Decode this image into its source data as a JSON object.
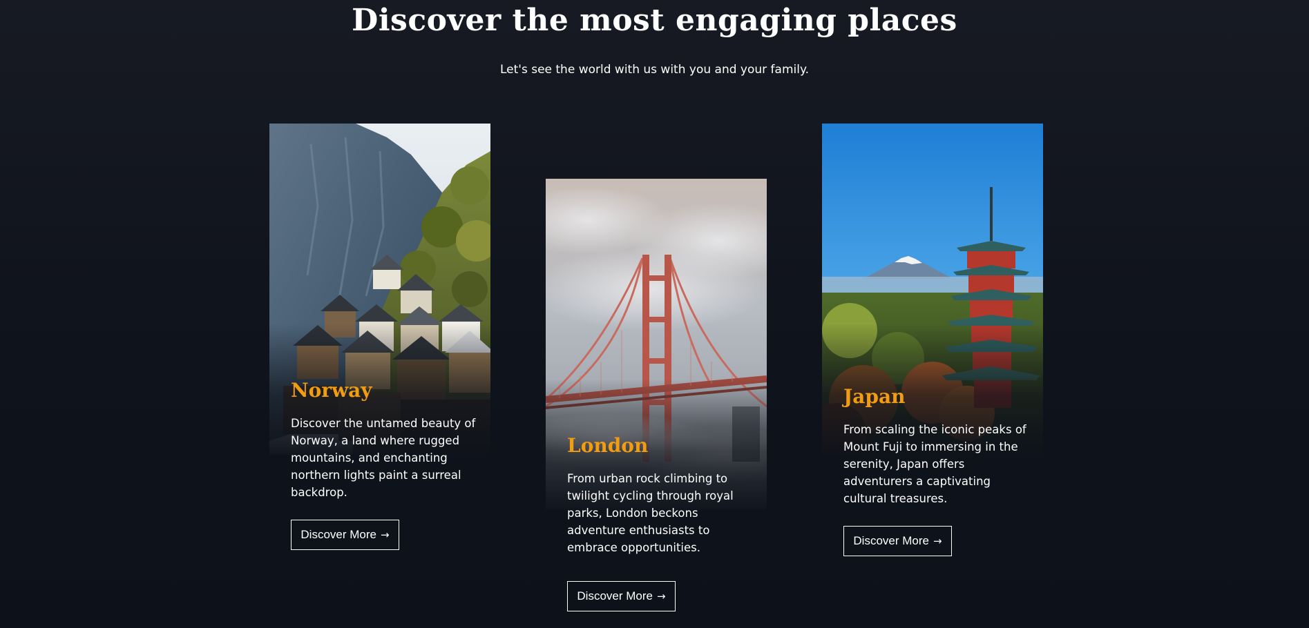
{
  "header": {
    "title": "Discover the most engaging places",
    "subtitle": "Let's see the world with us with you and your family."
  },
  "cards": [
    {
      "title": "Norway",
      "description": "Discover the untamed beauty of Norway, a land where rugged mountains, and enchanting northern lights paint a surreal backdrop.",
      "button_label": "Discover More",
      "button_icon": "arrow-right-icon",
      "image": "mountain-village-photo"
    },
    {
      "title": "London",
      "description": "From urban rock climbing to twilight cycling through royal parks, London beckons adventure enthusiasts to embrace opportunities.",
      "button_label": "Discover More",
      "button_icon": "arrow-right-icon",
      "image": "bridge-in-fog-photo"
    },
    {
      "title": "Japan",
      "description": "From scaling the iconic peaks of Mount Fuji to immersing in the serenity, Japan offers adventurers a captivating cultural treasures.",
      "button_label": "Discover More",
      "button_icon": "arrow-right-icon",
      "image": "pagoda-and-mount-fuji-photo"
    }
  ],
  "colors": {
    "background": "#12161f",
    "accent": "#f29c11",
    "text": "#ffffff"
  }
}
